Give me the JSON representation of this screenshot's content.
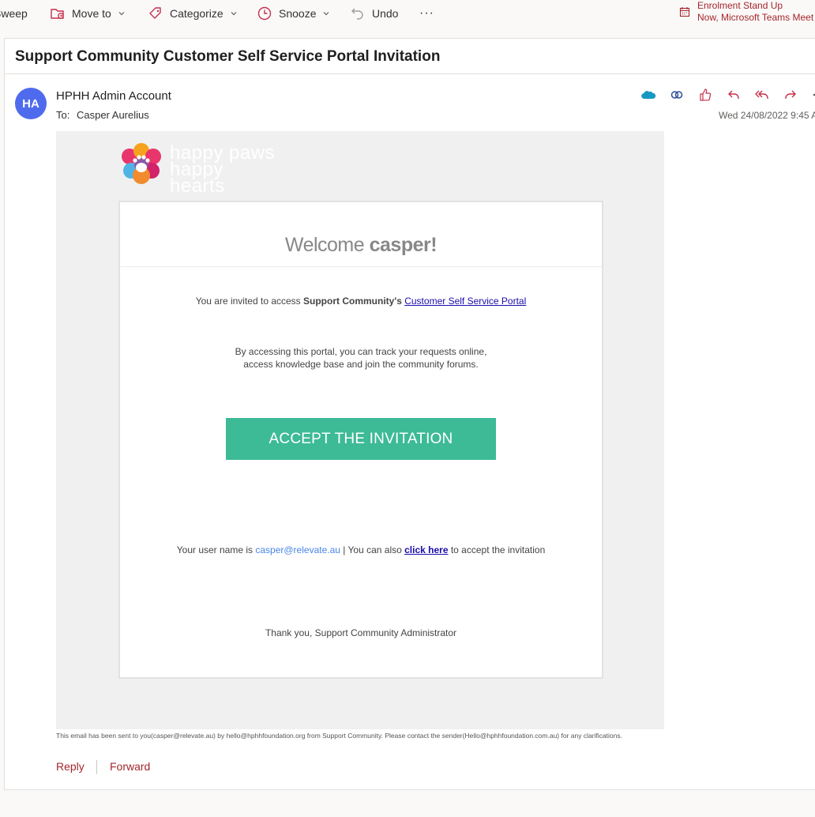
{
  "toolbar": {
    "sweep_label": "Sweep",
    "move_label": "Move to",
    "categorize_label": "Categorize",
    "snooze_label": "Snooze",
    "undo_label": "Undo",
    "more_label": "···"
  },
  "reminder": {
    "title": "Enrolment Stand Up",
    "subtitle": "Now, Microsoft Teams Meet"
  },
  "subject": "Support Community Customer Self Service Portal Invitation",
  "message": {
    "avatar_initials": "HA",
    "avatar_color": "#4f6bed",
    "sender": "HPHH Admin Account",
    "to_label": "To:",
    "to_name": "Casper Aurelius",
    "date": "Wed 24/08/2022 9:45 A",
    "action_icons": [
      "salesforce-icon",
      "link-icon",
      "like-icon",
      "reply-icon",
      "reply-all-icon",
      "forward-icon",
      "more-icon"
    ]
  },
  "email": {
    "logo_line1": "happy paws",
    "logo_line2": "happy hearts",
    "welcome_prefix": "Welcome ",
    "welcome_name": "casper!",
    "invite_prefix": "You are invited to access ",
    "invite_org": "Support Community's",
    "invite_link": "Customer Self Service Portal",
    "desc_line1": "By accessing this portal, you can track your requests online,",
    "desc_line2": "access knowledge base and join the community forums.",
    "accept_label": "ACCEPT THE INVITATION",
    "accept_color": "#3dba96",
    "username_prefix": "Your user name is ",
    "username_email": "casper@relevate.au",
    "username_mid": " | You can also ",
    "click_here": "click here",
    "username_suffix": " to accept the invitation",
    "thanks": "Thank you, Support Community Administrator"
  },
  "footer_note": "This email has been sent to you(casper@relevate.au) by hello@hphhfoundation.org from Support Community. Please contact the sender(Hello@hphhfoundation.com.au) for any clarifications.",
  "reply_label": "Reply",
  "forward_label": "Forward",
  "accent_color": "#a4262c"
}
